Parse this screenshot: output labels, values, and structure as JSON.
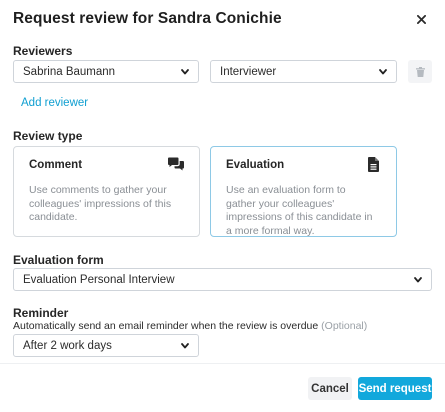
{
  "dialog": {
    "title": "Request review for Sandra Conichie",
    "close_icon": "close-icon"
  },
  "reviewers": {
    "label": "Reviewers",
    "person_value": "Sabrina Baumann",
    "role_value": "Interviewer",
    "add_label": "Add reviewer"
  },
  "review_type": {
    "label": "Review type",
    "options": [
      {
        "title": "Comment",
        "description": "Use comments to gather your colleagues' impressions of this candidate.",
        "icon": "comments-icon",
        "selected": false
      },
      {
        "title": "Evaluation",
        "description": "Use an evaluation form to gather your colleagues' impressions of this candidate in a more formal way.",
        "icon": "document-icon",
        "selected": true
      }
    ]
  },
  "evaluation_form": {
    "label": "Evaluation form",
    "value": "Evaluation Personal Interview"
  },
  "reminder": {
    "label": "Reminder",
    "hint": "Automatically send an email reminder when the review is overdue",
    "optional": "(Optional)",
    "value": "After 2 work days"
  },
  "footer": {
    "cancel_label": "Cancel",
    "send_label": "Send request"
  },
  "colors": {
    "accent": "#12a8dc",
    "link": "#0f9fd1",
    "selected_border": "#8ec9e6"
  }
}
